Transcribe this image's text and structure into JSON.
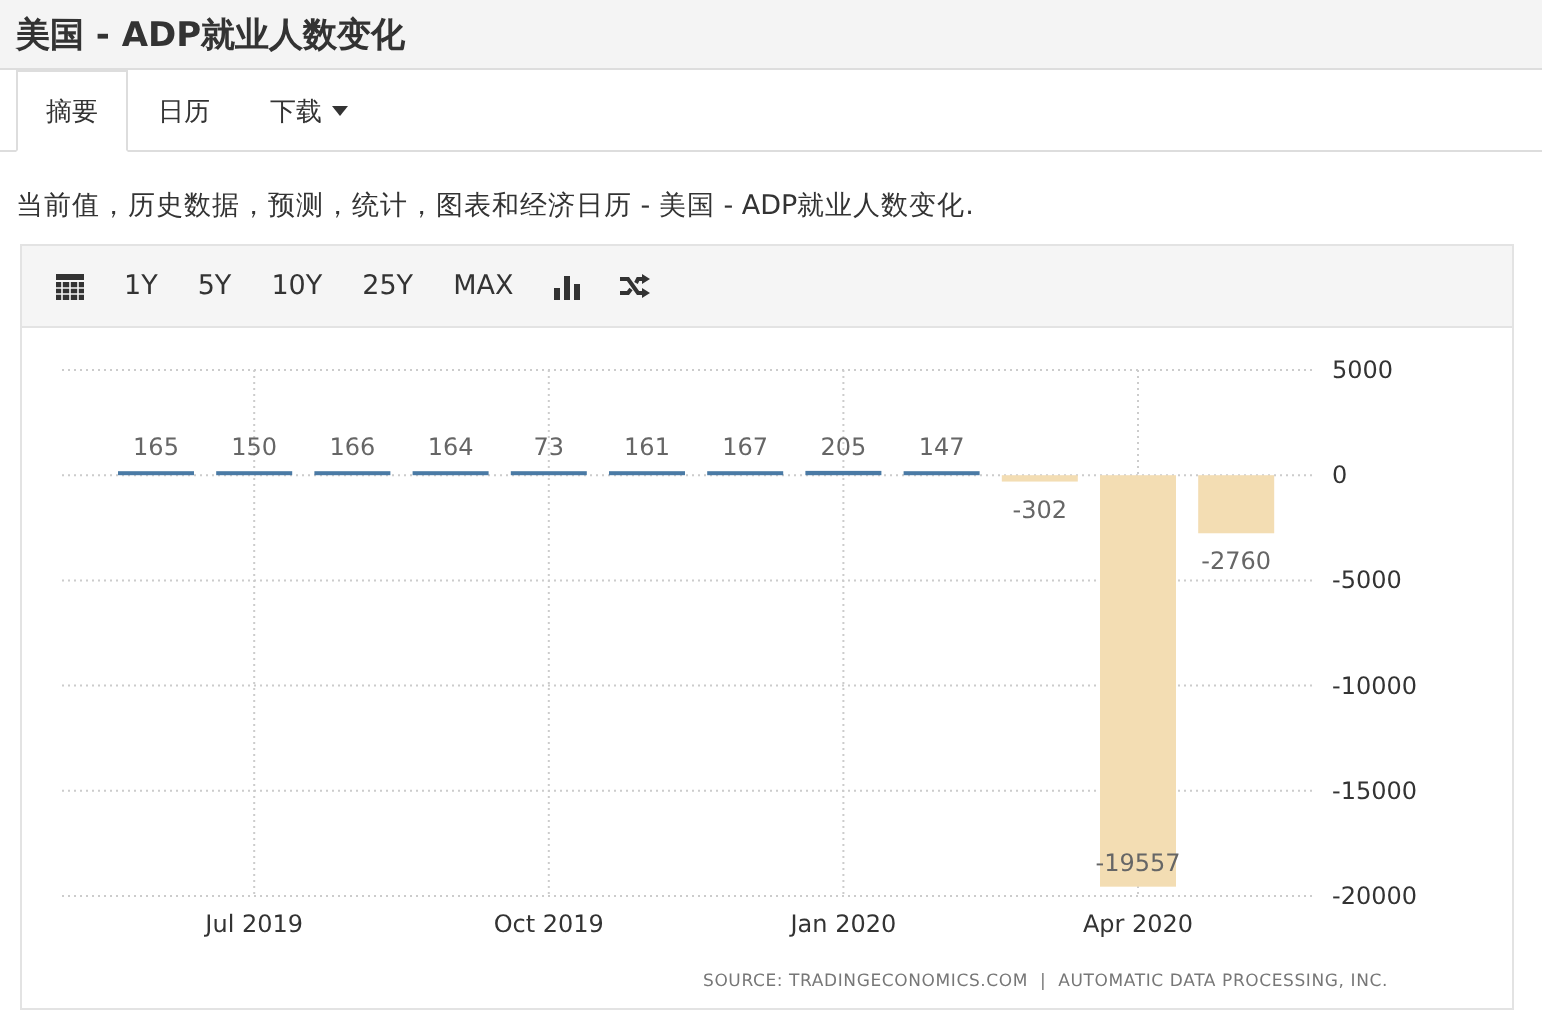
{
  "title": "美国 - ADP就业人数变化",
  "tabs": [
    {
      "label": "摘要",
      "selected": true,
      "dropdown": false
    },
    {
      "label": "日历",
      "selected": false,
      "dropdown": false
    },
    {
      "label": "下载",
      "selected": false,
      "dropdown": true
    }
  ],
  "description": "当前值，历史数据，预测，统计，图表和经济日历 - 美国 - ADP就业人数变化.",
  "toolbar": [
    {
      "kind": "calendar"
    },
    {
      "kind": "text",
      "label": "1Y"
    },
    {
      "kind": "text",
      "label": "5Y"
    },
    {
      "kind": "text",
      "label": "10Y"
    },
    {
      "kind": "text",
      "label": "25Y"
    },
    {
      "kind": "text",
      "label": "MAX"
    },
    {
      "kind": "bars"
    },
    {
      "kind": "shuffle"
    }
  ],
  "chart": {
    "chart_data": {
      "type": "bar",
      "categories": [
        null,
        "Jul 2019",
        null,
        null,
        "Oct 2019",
        null,
        null,
        "Jan 2020",
        null,
        null,
        "Apr 2020",
        null
      ],
      "stacked": true,
      "series": [
        {
          "color": "#4a7aa5",
          "values": [
            165,
            150,
            166,
            164,
            73,
            161,
            167,
            205,
            147,
            null,
            null,
            null
          ]
        },
        {
          "color": "#f3ddb3",
          "values": [
            null,
            null,
            null,
            null,
            null,
            null,
            null,
            null,
            null,
            -302,
            -19557,
            -2760
          ]
        }
      ],
      "grid": true,
      "ylim": [
        -20000,
        5000
      ],
      "yticks": [
        5000,
        0,
        -5000,
        -10000,
        -15000,
        -20000
      ],
      "value_labels": [
        "165",
        "150",
        "166",
        "164",
        "73",
        "161",
        "167",
        "205",
        "147",
        "-302",
        "-19557",
        "-2760"
      ]
    },
    "source": "SOURCE: TRADINGECONOMICS.COM  |  AUTOMATIC DATA PROCESSING, INC."
  }
}
